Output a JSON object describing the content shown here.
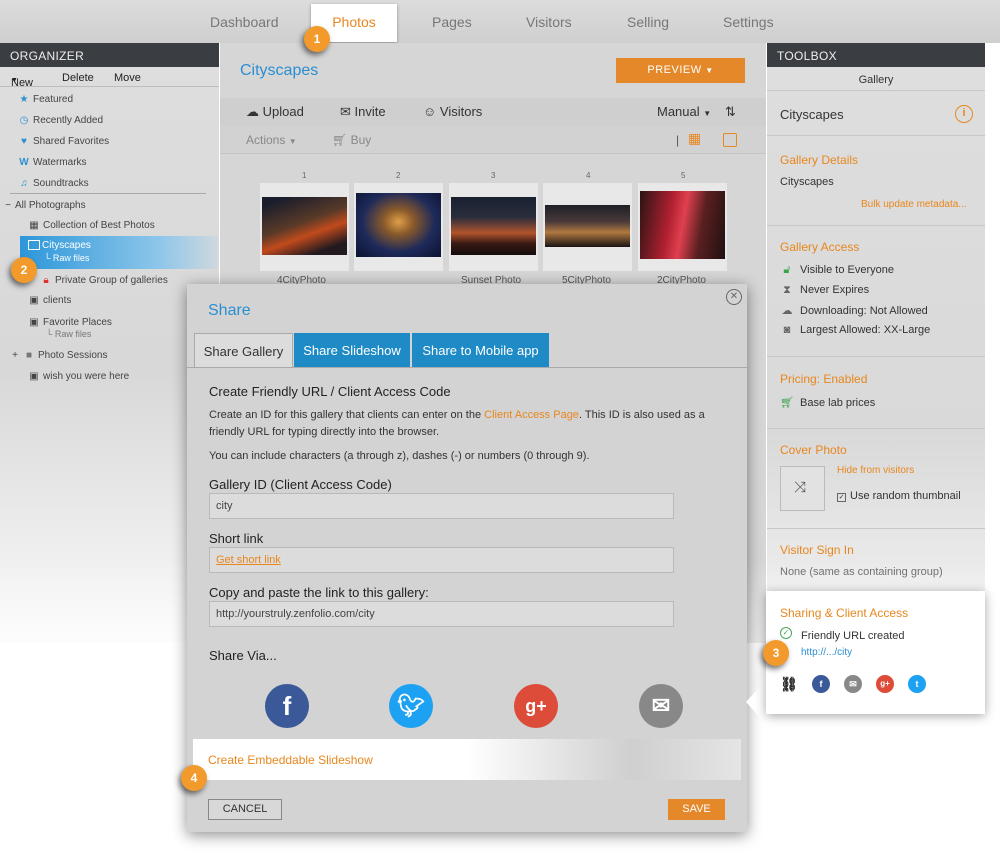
{
  "nav": {
    "items": [
      {
        "label": "Dashboard"
      },
      {
        "label": "Photos"
      },
      {
        "label": "Pages"
      },
      {
        "label": "Visitors"
      },
      {
        "label": "Selling"
      },
      {
        "label": "Settings"
      }
    ],
    "active": "Photos"
  },
  "badges": [
    "1",
    "2",
    "3",
    "4"
  ],
  "organizer": {
    "title": "ORGANIZER",
    "actions": {
      "new": "New",
      "delete": "Delete",
      "move": "Move"
    },
    "favorites": [
      {
        "label": "Featured",
        "icon": "star-icon"
      },
      {
        "label": "Recently Added",
        "icon": "clock-icon"
      },
      {
        "label": "Shared Favorites",
        "icon": "heart-icon"
      },
      {
        "label": "Watermarks",
        "icon": "watermark-icon"
      },
      {
        "label": "Soundtracks",
        "icon": "music-note-icon"
      }
    ],
    "root": "All Photographs",
    "items": {
      "collection": "Collection of Best Photos",
      "cityscapes": "Cityscapes",
      "cityscapes_sub": "Raw files",
      "private_group": "Private Group of galleries",
      "clients": "clients",
      "favorite_places": "Favorite Places",
      "favorite_places_sub": "Raw files",
      "photo_sessions": "Photo Sessions",
      "wish": "wish you were here"
    }
  },
  "main": {
    "gallery_title": "Cityscapes",
    "preview_label": "PREVIEW",
    "toolbar": {
      "upload": "Upload",
      "invite": "Invite",
      "visitors": "Visitors",
      "sort": "Manual"
    },
    "toolbar2": {
      "actions": "Actions",
      "buy": "Buy"
    },
    "thumbs": [
      {
        "num": "1",
        "name": "4CityPhoto"
      },
      {
        "num": "2",
        "name": ""
      },
      {
        "num": "3",
        "name": "Sunset Photo"
      },
      {
        "num": "4",
        "name": "5CityPhoto"
      },
      {
        "num": "5",
        "name": "2CityPhoto"
      }
    ]
  },
  "toolbox": {
    "title": "TOOLBOX",
    "subtitle": "Gallery",
    "gallery_name": "Cityscapes",
    "details": {
      "heading": "Gallery Details",
      "name": "Cityscapes",
      "bulk_link": "Bulk update metadata..."
    },
    "access": {
      "heading": "Gallery Access",
      "items": [
        {
          "label": "Visible to Everyone",
          "icon": "unlock-icon"
        },
        {
          "label": "Never Expires",
          "icon": "hourglass-icon"
        },
        {
          "label": "Downloading: Not Allowed",
          "icon": "cloud-download-icon"
        },
        {
          "label": "Largest Allowed: XX-Large",
          "icon": "camera-icon"
        }
      ]
    },
    "pricing": {
      "heading": "Pricing: Enabled",
      "item": "Base lab prices"
    },
    "cover": {
      "heading": "Cover Photo",
      "hide_link": "Hide from visitors",
      "random_label": "Use random thumbnail"
    },
    "visitor_signin": {
      "heading": "Visitor Sign In",
      "value": "None (same as containing group)"
    },
    "sharing": {
      "heading": "Sharing & Client Access",
      "status": "Friendly URL created",
      "link": "http://.../city"
    }
  },
  "modal": {
    "title": "Share",
    "tabs": [
      "Share Gallery",
      "Share Slideshow",
      "Share to Mobile app"
    ],
    "section_title": "Create Friendly URL / Client Access Code",
    "desc1_a": "Create an ID for this gallery that clients can enter on the ",
    "desc1_link": "Client Access Page",
    "desc1_b": ". This ID is also used as a",
    "desc2": "friendly URL for typing directly into the browser.",
    "desc3": "You can include characters (a through z), dashes (-) or numbers (0 through 9).",
    "gallery_id_label": "Gallery ID (Client Access Code)",
    "gallery_id_value": "city",
    "short_link_label": "Short link",
    "short_link_action": "Get short link",
    "copy_label": "Copy and paste the link to this gallery:",
    "copy_value": "http://yourstruly.zenfolio.com/city",
    "share_via": "Share Via...",
    "embed_link": "Create Embeddable Slideshow",
    "cancel": "CANCEL",
    "save": "SAVE"
  },
  "colors": {
    "accent": "#e8871e",
    "link": "#2a8fd1",
    "facebook": "#3b5998",
    "twitter": "#1da1f2",
    "google": "#dd4b39",
    "email": "#888888"
  }
}
